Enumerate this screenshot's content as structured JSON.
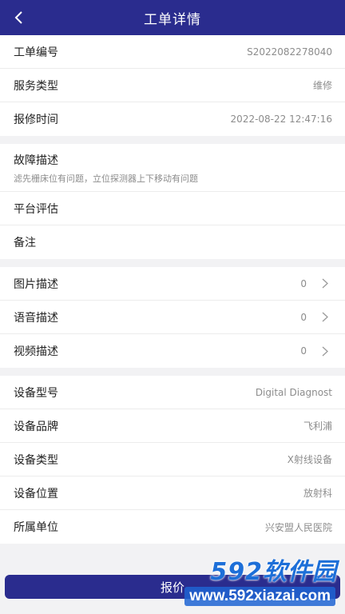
{
  "header": {
    "title": "工单详情"
  },
  "info": [
    {
      "label": "工单编号",
      "value": "S2022082278040"
    },
    {
      "label": "服务类型",
      "value": "维修"
    },
    {
      "label": "报修时间",
      "value": "2022-08-22 12:47:16"
    }
  ],
  "fault": {
    "label": "故障描述",
    "desc": "滤先栅床位有问题，立位探测器上下移动有问题",
    "evaluation_label": "平台评估",
    "remark_label": "备注"
  },
  "media": [
    {
      "label": "图片描述",
      "count": "0"
    },
    {
      "label": "语音描述",
      "count": "0"
    },
    {
      "label": "视频描述",
      "count": "0"
    }
  ],
  "device": [
    {
      "label": "设备型号",
      "value": "Digital Diagnost"
    },
    {
      "label": "设备品牌",
      "value": "飞利浦"
    },
    {
      "label": "设备类型",
      "value": "X射线设备"
    },
    {
      "label": "设备位置",
      "value": "放射科"
    },
    {
      "label": "所属单位",
      "value": "兴安盟人民医院"
    }
  ],
  "footer": {
    "button_label": "报价"
  },
  "watermark": {
    "brand": "592软件园",
    "url": "www.592xiazai.com"
  },
  "colors": {
    "primary": "#2a2c8e",
    "muted_text": "#8c8c8c",
    "background": "#f2f2f4"
  }
}
